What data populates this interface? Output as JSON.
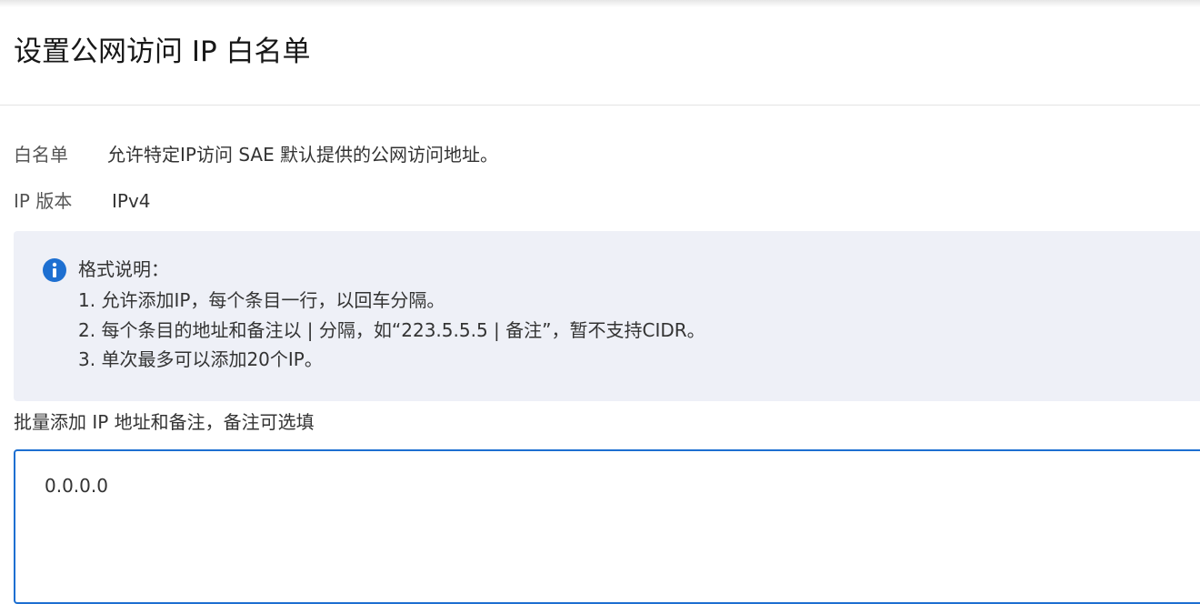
{
  "header": {
    "title": "设置公网访问 IP 白名单"
  },
  "info": {
    "whitelist_label": "白名单",
    "whitelist_value": "允许特定IP访问 SAE 默认提供的公网访问地址。",
    "version_label": "IP 版本",
    "version_value": "IPv4"
  },
  "notice": {
    "icon": "info-icon",
    "icon_color": "#1d6fd1",
    "title": "格式说明：",
    "items": [
      "1. 允许添加IP，每个条目一行，以回车分隔。",
      "2. 每个条目的地址和备注以 | 分隔，如“223.5.5.5 | 备注”，暂不支持CIDR。",
      "3. 单次最多可以添加20个IP。"
    ]
  },
  "input": {
    "label": "批量添加 IP 地址和备注，备注可选填",
    "value": "0.0.0.0"
  },
  "colors": {
    "accent": "#1d6fd1",
    "notice_background": "#eef0f7"
  }
}
